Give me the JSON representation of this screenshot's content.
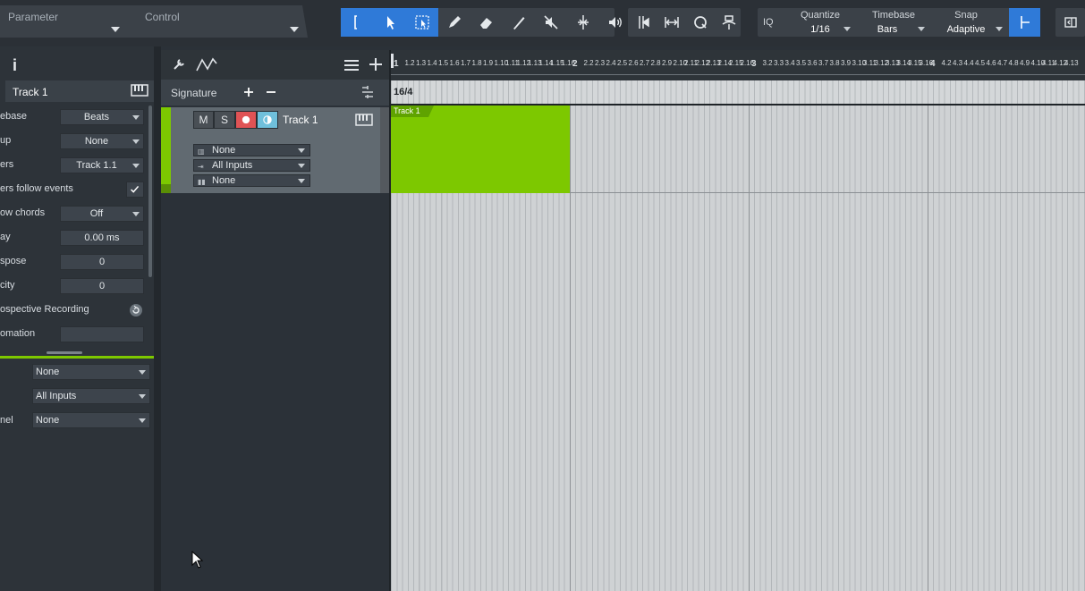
{
  "toolbar": {
    "parameter_label": "Parameter",
    "control_label": "Control",
    "iq_label": "IQ",
    "quantize_label": "Quantize",
    "quantize_value": "1/16",
    "timebase_label": "Timebase",
    "timebase_value": "Bars",
    "snap_label": "Snap",
    "snap_value": "Adaptive",
    "active_color": "#2f7ad8"
  },
  "inspector": {
    "info_icon": "i",
    "track_name": "Track 1",
    "rows": [
      {
        "label": "ebase",
        "value": "Beats"
      },
      {
        "label": "up",
        "value": "None"
      },
      {
        "label": "ers",
        "value": "Track 1.1"
      },
      {
        "label": "ers follow events"
      },
      {
        "label": "ow chords",
        "value": "Off"
      },
      {
        "label": "ay",
        "value": "0.00 ms"
      },
      {
        "label": "spose",
        "value": "0"
      },
      {
        "label": "city",
        "value": "0"
      },
      {
        "label": "ospective Recording"
      },
      {
        "label": "omation",
        "value": ""
      }
    ],
    "lower": [
      {
        "label": "",
        "value": "None"
      },
      {
        "label": "",
        "value": "All Inputs"
      },
      {
        "label": "nel",
        "value": "None"
      }
    ],
    "accent": "#7dc800"
  },
  "tracks": {
    "signature_label": "Signature",
    "signature_value": "16/4",
    "mute": "M",
    "solo": "S",
    "track_name": "Track 1",
    "output": "None",
    "input": "All Inputs",
    "channel": "None",
    "clip_name": "Track 1",
    "clip_color": "#7dc800"
  },
  "ruler": {
    "labels": [
      "1",
      "1.2",
      "1.3",
      "1.4",
      "1.5",
      "1.6",
      "1.7",
      "1.8",
      "1.9",
      "1.10",
      "1.11",
      "1.12",
      "1.13",
      "1.14",
      "1.15",
      "1.16",
      "2",
      "2.2",
      "2.3",
      "2.4",
      "2.5",
      "2.6",
      "2.7",
      "2.8",
      "2.9",
      "2.10",
      "2.11",
      "2.12",
      "2.13",
      "2.14",
      "2.15",
      "2.16",
      "3",
      "3.2",
      "3.3",
      "3.4",
      "3.5",
      "3.6",
      "3.7",
      "3.8",
      "3.9",
      "3.10",
      "3.11",
      "3.12",
      "3.13",
      "3.14",
      "3.15",
      "3.16",
      "4",
      "4.2",
      "4.3",
      "4.4",
      "4.5",
      "4.6",
      "4.7",
      "4.8",
      "4.9",
      "4.10",
      "4.11",
      "4.12",
      "4.13"
    ]
  }
}
